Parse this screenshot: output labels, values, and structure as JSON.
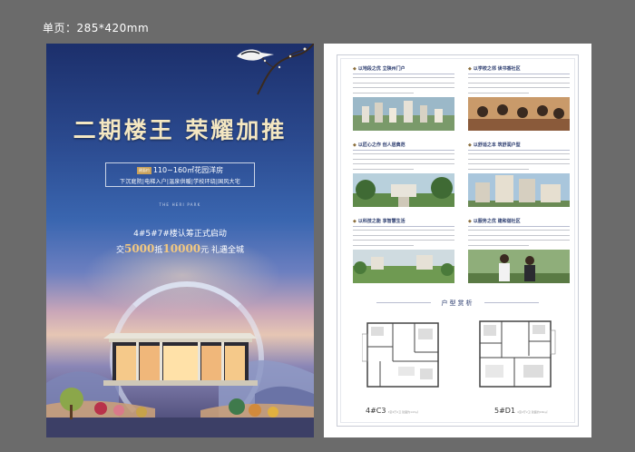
{
  "size_label": "单页：285*420mm",
  "front": {
    "headline": "二期楼王 荣耀加推",
    "spec_tag": "建面约",
    "spec_area": "110~160㎡花园洋房",
    "spec_features": "下沉庭院|电梯入户|温泉供暖|学校环绕|国风大宅",
    "park_name": "THE HERI PARK",
    "launch_text": "4#5#7#楼认筹正式启动",
    "offer_prefix": "交",
    "offer_amount1": "5000",
    "offer_mid": "抵",
    "offer_amount2": "10000",
    "offer_suffix": "元 礼遇全城"
  },
  "back": {
    "sections": [
      {
        "title": "以地段之优  立陕州门户"
      },
      {
        "title": "以学校之邻  读书香社区"
      },
      {
        "title": "以匠心之作  创人居典范"
      },
      {
        "title": "以舒适之本  筑舒润户型"
      },
      {
        "title": "以科技之能  享智慧生活"
      },
      {
        "title": "以服务之优  建和谐社区"
      }
    ],
    "plans_title": "户型赏析",
    "plans": [
      {
        "name": "4#C3",
        "note": "3室2厅2卫 建面约143㎡"
      },
      {
        "name": "5#D1",
        "note": "4室2厅2卫 建面约160㎡"
      }
    ]
  },
  "colors": {
    "headline_gold": "#f4e7c2",
    "offer_gold": "#f2c880",
    "navy": "#2a3b6e",
    "background": "#6b6b6b"
  }
}
